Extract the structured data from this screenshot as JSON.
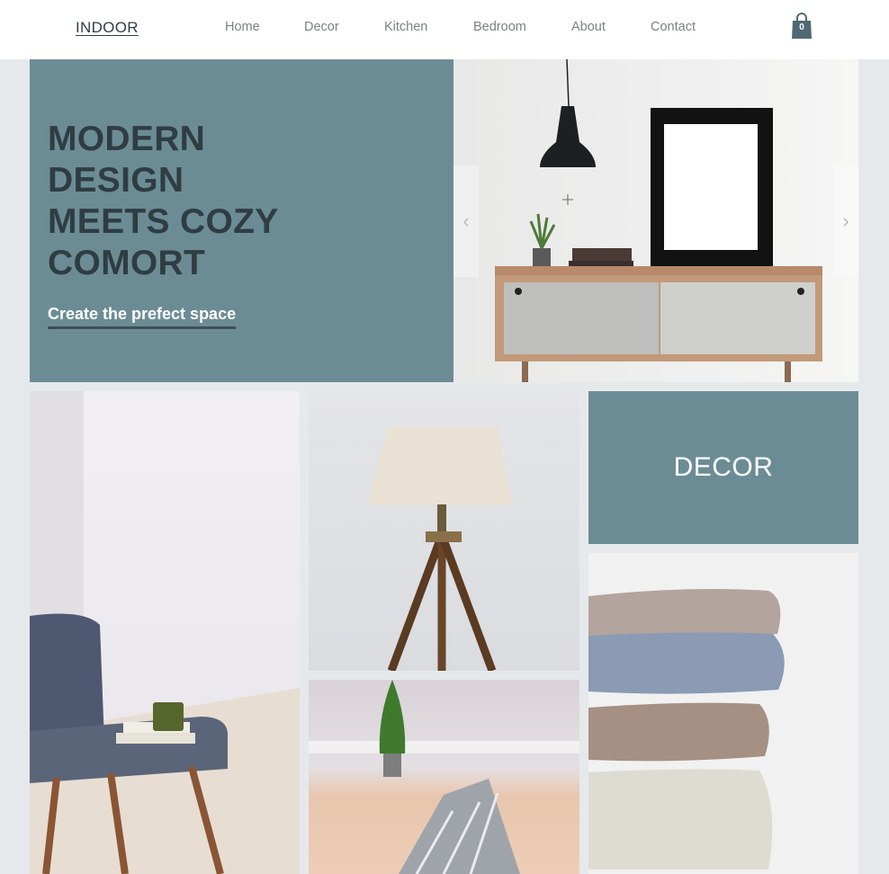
{
  "header": {
    "logo": "INDOOR",
    "nav": [
      "Home",
      "Decor",
      "Kitchen",
      "Bedroom",
      "About",
      "Contact"
    ],
    "cart_count": "0"
  },
  "hero": {
    "title": "MODERN\nDESIGN\nMEETS COZY\nCOMORT",
    "link_label": "Create the prefect space",
    "prev_arrow": "‹",
    "next_arrow": "›"
  },
  "tiles": {
    "decor_label": "DECOR"
  },
  "colors": {
    "accent": "#6c8c95",
    "heading": "#2f3d42",
    "background": "#e6e9eb"
  }
}
